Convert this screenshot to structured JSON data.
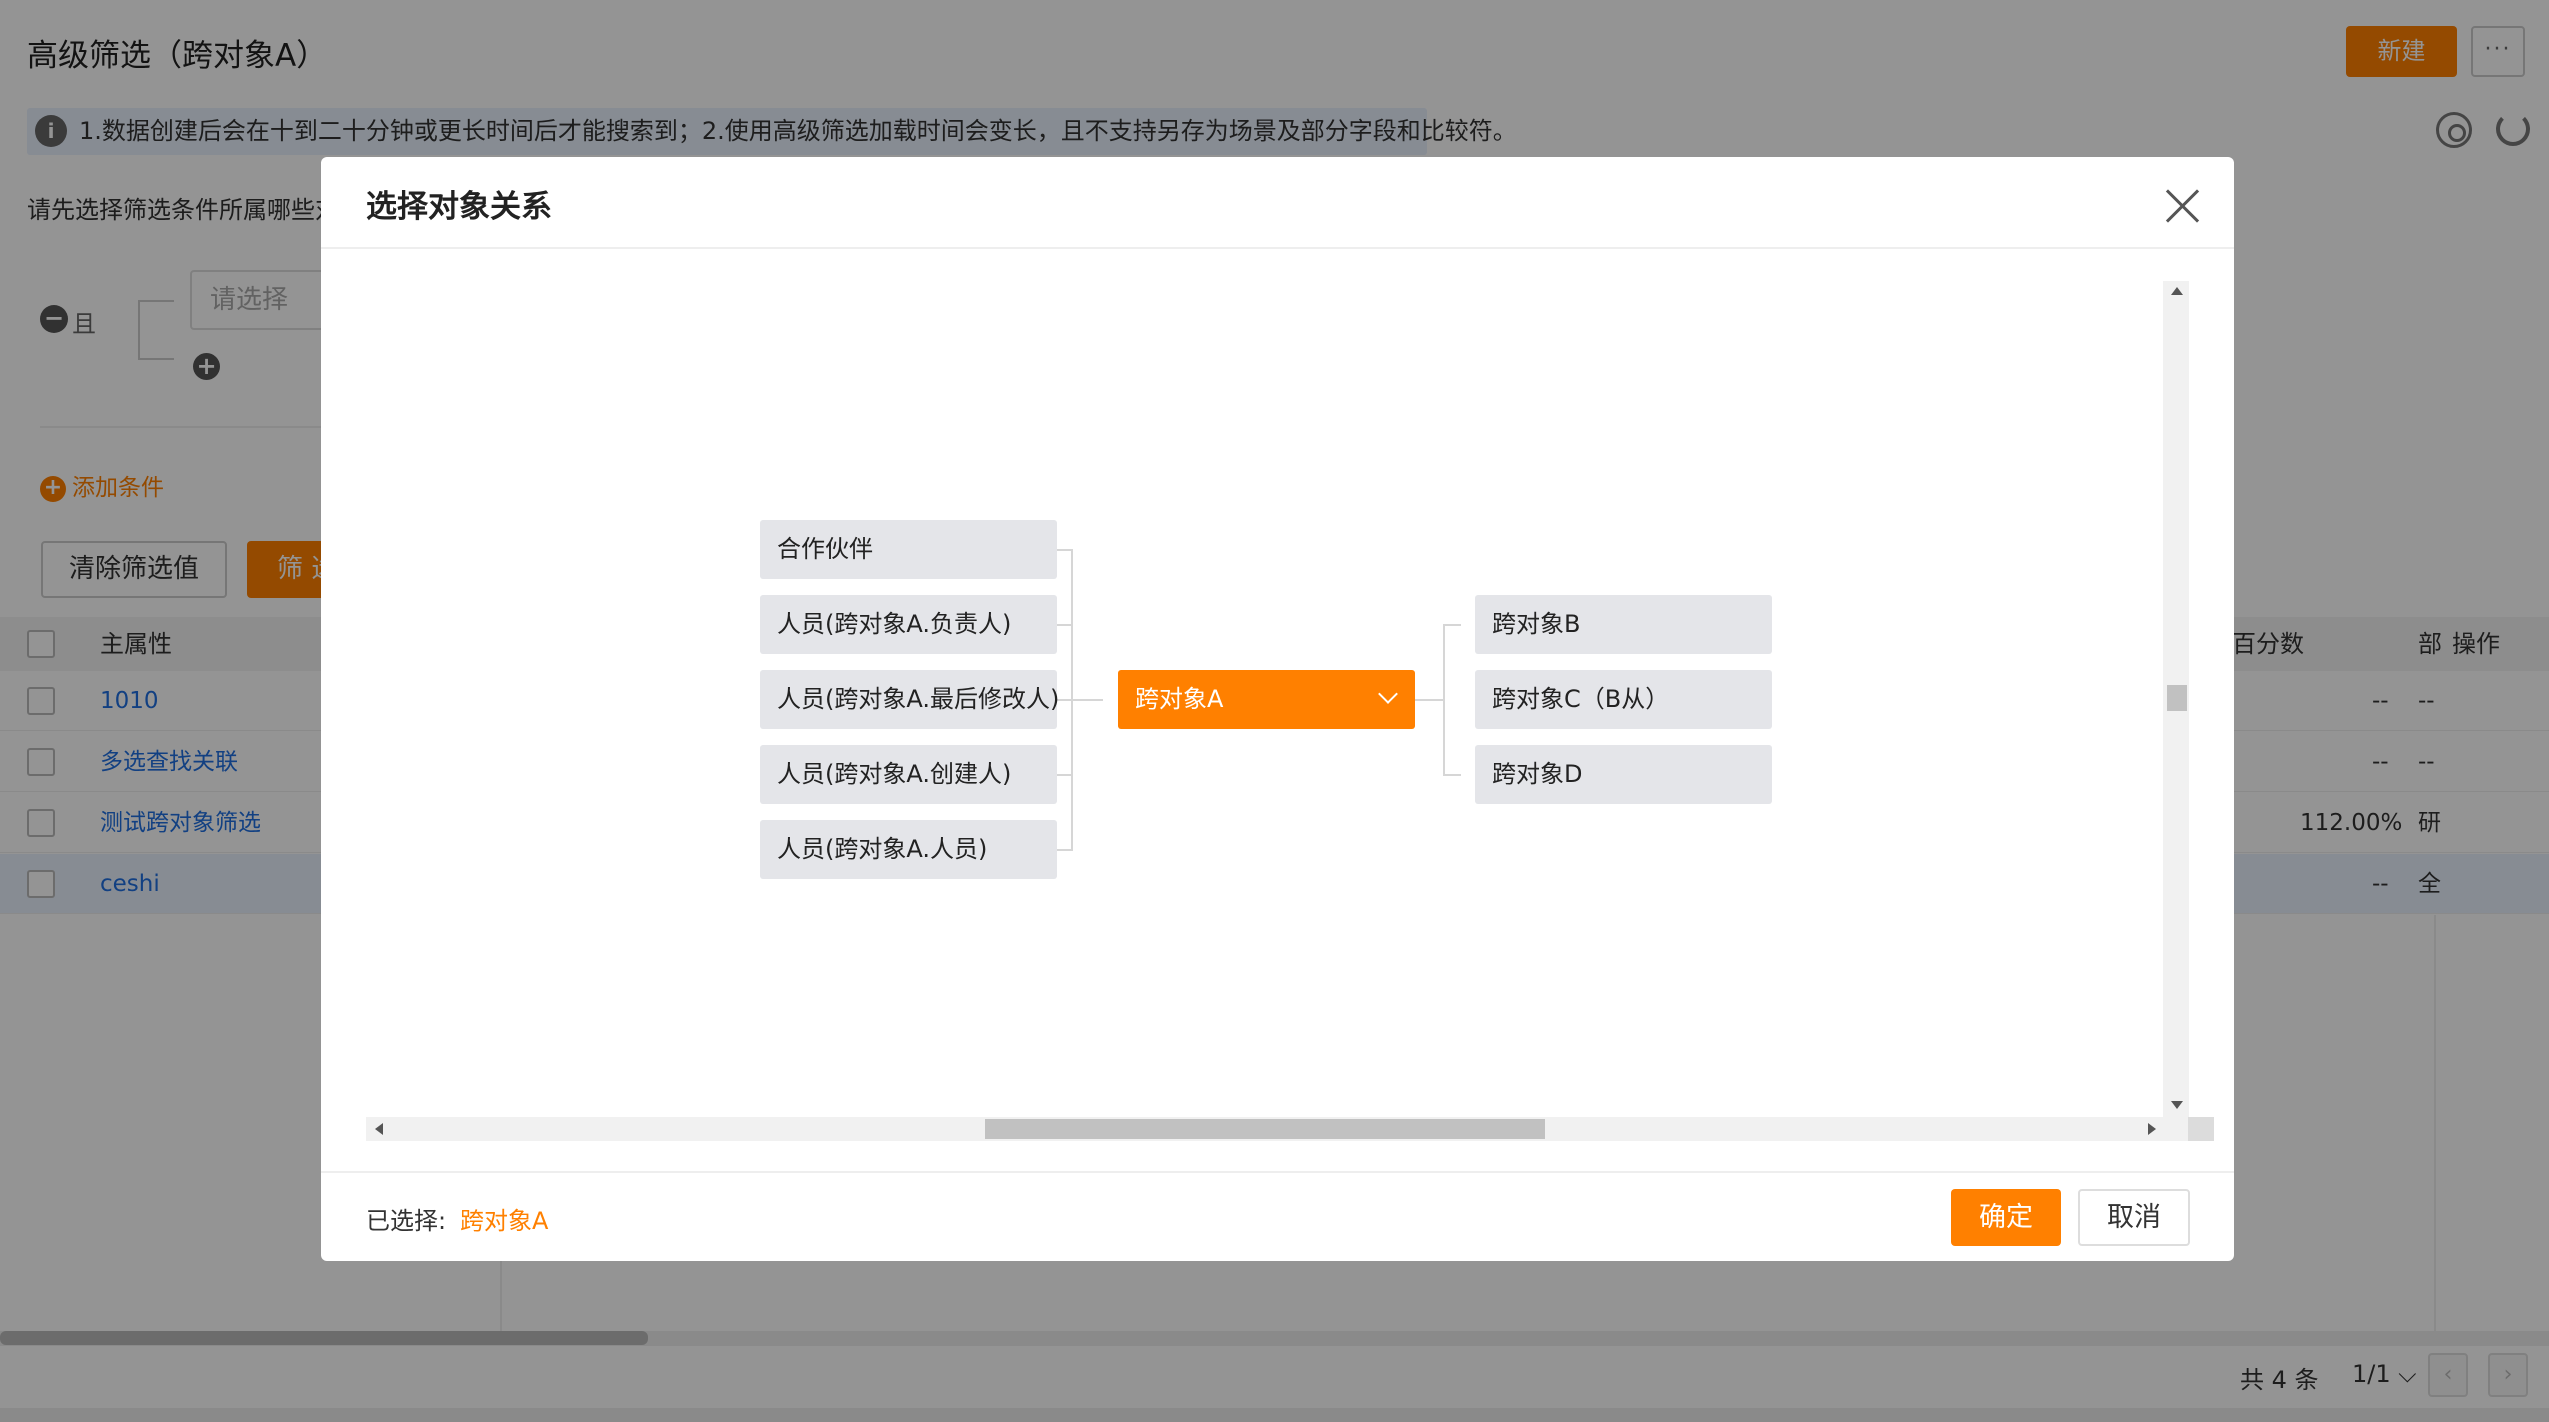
{
  "page": {
    "title": "高级筛选（跨对象A）",
    "new_button": "新建",
    "more_button": "···",
    "notice": "1.数据创建后会在十到二十分钟或更长时间后才能搜索到；2.使用高级筛选加载时间会变长，且不支持另存为场景及部分字段和比较符。",
    "hint": "请先选择筛选条件所属哪些对",
    "logic_label": "且",
    "select_placeholder": "请选择",
    "add_condition": "添加条件",
    "clear_button": "清除筛选值",
    "filter_button": "筛 选"
  },
  "table": {
    "headers": {
      "main": "主属性",
      "percent": "百分数",
      "dept": "部",
      "actions": "操作"
    },
    "rows": [
      {
        "name": "1010",
        "percent": "--",
        "dept": "--"
      },
      {
        "name": "多选查找关联",
        "percent": "--",
        "dept": "--"
      },
      {
        "name": "测试跨对象筛选",
        "percent": "112.00%",
        "dept": "研"
      },
      {
        "name": "ceshi",
        "percent": "--",
        "dept": "全"
      }
    ]
  },
  "pagination": {
    "total": "共 4 条",
    "page": "1/1"
  },
  "modal": {
    "title": "选择对象关系",
    "left_nodes": [
      "合作伙伴",
      "人员(跨对象A.负责人)",
      "人员(跨对象A.最后修改人)",
      "人员(跨对象A.创建人)",
      "人员(跨对象A.人员)"
    ],
    "center_node": "跨对象A",
    "right_nodes": [
      "跨对象B",
      "跨对象C（B从）",
      "跨对象D"
    ],
    "selected_label": "已选择:",
    "selected_value": "跨对象A",
    "confirm_button": "确定",
    "cancel_button": "取消"
  },
  "colors": {
    "accent": "#ff8000",
    "link": "#1f6fe0",
    "node_bg": "#e4e5e9"
  }
}
